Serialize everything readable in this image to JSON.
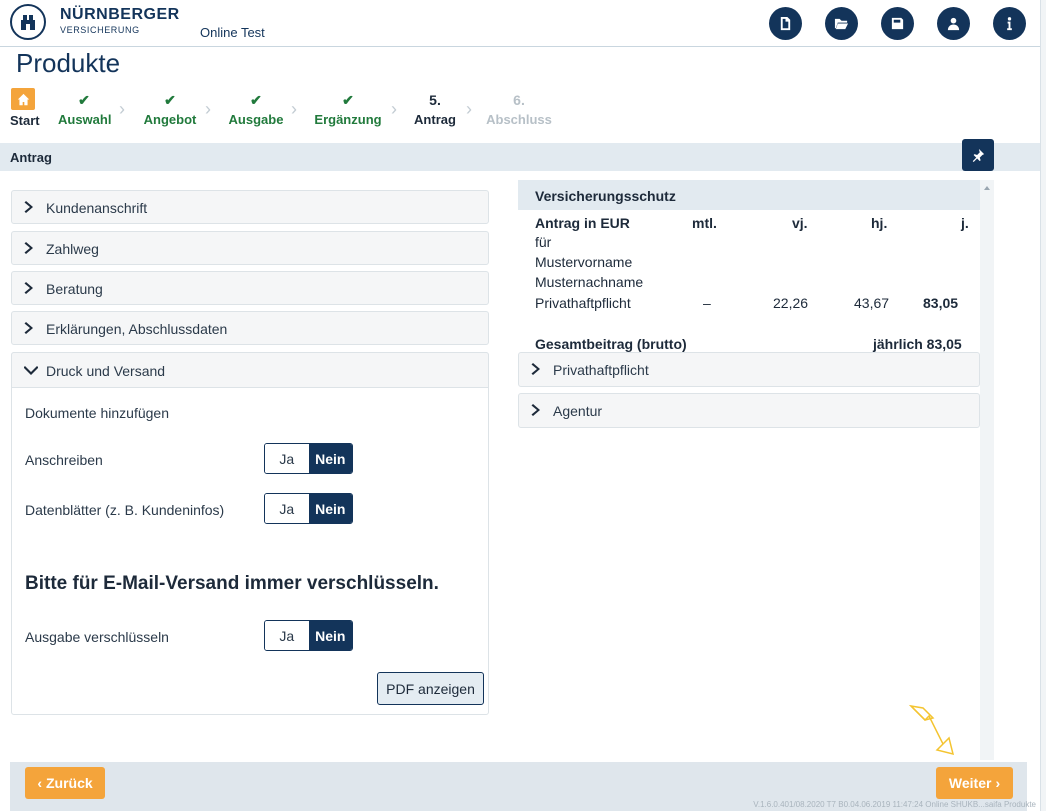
{
  "header": {
    "brand": "NÜRNBERGER",
    "brand_sub": "VERSICHERUNG",
    "app_name": "Online Test",
    "buttons": [
      {
        "icon": "new-document-icon"
      },
      {
        "icon": "open-folder-icon"
      },
      {
        "icon": "save-icon"
      },
      {
        "icon": "user-icon"
      },
      {
        "icon": "info-icon"
      }
    ]
  },
  "page_title": "Produkte",
  "steps": [
    {
      "label": "Start",
      "mark": "home-icon",
      "state": "done"
    },
    {
      "label": "Auswahl",
      "mark": "✔",
      "state": "done"
    },
    {
      "label": "Angebot",
      "mark": "✔",
      "state": "done"
    },
    {
      "label": "Ausgabe",
      "mark": "✔",
      "state": "done"
    },
    {
      "label": "Ergänzung",
      "mark": "✔",
      "state": "done"
    },
    {
      "label": "Antrag",
      "mark": "5.",
      "state": "active"
    },
    {
      "label": "Abschluss",
      "mark": "6.",
      "state": "disabled"
    }
  ],
  "section": {
    "title": "Antrag"
  },
  "accordions": [
    {
      "label": "Kundenanschrift"
    },
    {
      "label": "Zahlweg"
    },
    {
      "label": "Beratung"
    },
    {
      "label": "Erklärungen, Abschlussdaten"
    }
  ],
  "druck": {
    "title": "Druck und Versand",
    "docs_label": "Dokumente hinzufügen",
    "rows": [
      {
        "label": "Anschreiben",
        "ja": "Ja",
        "nein": "Nein",
        "selected": "Nein"
      },
      {
        "label": "Datenblätter (z. B. Kundeninfos)",
        "ja": "Ja",
        "nein": "Nein",
        "selected": "Nein"
      }
    ],
    "encrypt_heading": "Bitte für E-Mail-Versand immer verschlüsseln.",
    "encrypt_row": {
      "label": "Ausgabe verschlüsseln",
      "ja": "Ja",
      "nein": "Nein",
      "selected": "Nein"
    },
    "pdf_button": "PDF anzeigen"
  },
  "versicherungsschutz": {
    "title": "Versicherungsschutz",
    "col_label": "Antrag in EUR",
    "cols": [
      "mtl.",
      "vj.",
      "hj.",
      "j."
    ],
    "fuer": "für",
    "vorname": "Mustervorname",
    "nachname": "Musternachname",
    "row": {
      "label": "Privathaftpflicht",
      "mtl": "–",
      "vj": "22,26",
      "hj": "43,67",
      "j": "83,05"
    },
    "total_label": "Gesamtbeitrag (brutto)",
    "total_value": "jährlich 83,05"
  },
  "right_accordions": [
    {
      "label": "Privathaftpflicht"
    },
    {
      "label": "Agentur"
    }
  ],
  "footer": {
    "back": "Zurück",
    "next": "Weiter",
    "version": "V.1.6.0.401/08.2020 T7 B0.04.06.2019 11:47:24 Online SHUKB...saifa Produkte"
  },
  "colors": {
    "primary": "#13345a",
    "accent": "#f4a43b",
    "success": "#217a3c"
  }
}
